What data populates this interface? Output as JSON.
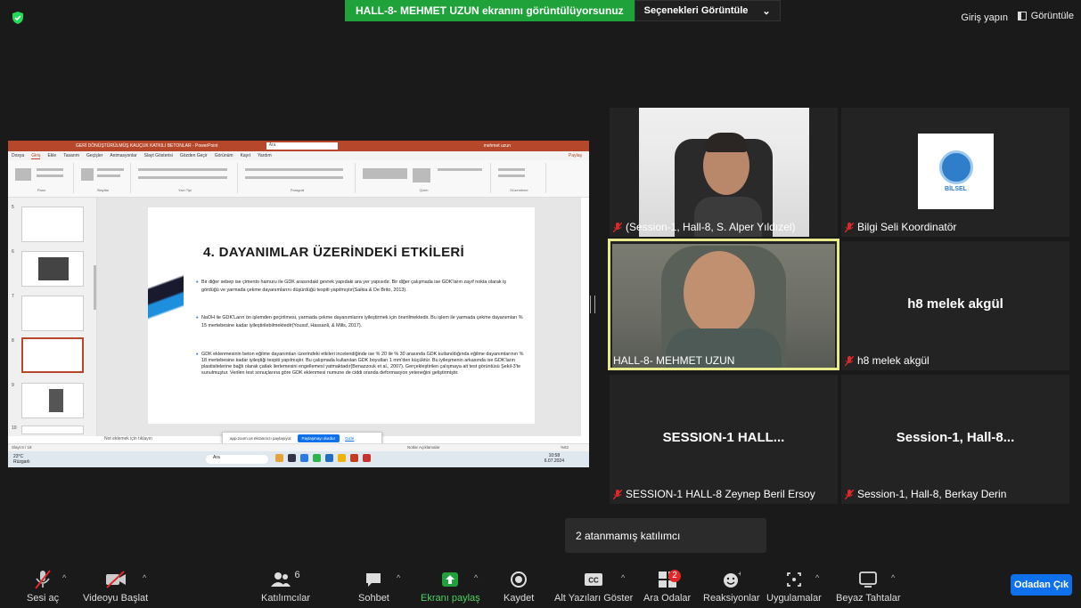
{
  "top": {
    "share_status": "HALL-8- MEHMET UZUN  ekranını görüntülüyorsunuz",
    "view_options": "Seçenekleri Görüntüle",
    "view_options_caret": "⌄",
    "signin": "Giriş yapın",
    "view": "Görüntüle"
  },
  "powerpoint": {
    "title": "GERİ DÖNÜŞTÜRÜLMÜŞ KAUÇUK KATKILI BETONLAR - PowerPoint",
    "search": "Ara",
    "user": "mehmet uzun",
    "menu": [
      "Dosya",
      "Giriş",
      "Ekle",
      "Tasarım",
      "Geçişler",
      "Animasyonlar",
      "Slayt Gösterisi",
      "Gözden Geçir",
      "Görünüm",
      "Kayıt",
      "Yardım"
    ],
    "share": "Paylaş",
    "ribbon_groups": [
      "Pano",
      "Slaytlar",
      "Yazı Tipi",
      "Paragraf",
      "Çizim",
      "Düzenleme"
    ],
    "thumb_numbers": [
      "5",
      "6",
      "7",
      "8",
      "9",
      "10"
    ],
    "notes": "Not eklemek için tıklayın",
    "status": "Slayt 8 / 18",
    "status_right": "Notlar   Açıklamalar",
    "zoom": "%82"
  },
  "slide": {
    "title": "4. DAYANIMLAR ÜZERİNDEKİ ETKİLERİ",
    "bullets": [
      "Bir diğer sebep ise çimento hamuru ile GDK arasındaki gevrek yapıdaki ara yer yapısıdır. Bir diğer çalışmada ise GDK'ların zayıf nokta olarak iş gördüğü ve yarmada çekme dayanımlarını düşürdüğü tespiti yapılmıştır(Saikia & De Brito, 2013).",
      "NaOH ile GDK'Ların ön işlemden geçirilmesi, yarmada çekme dayanımlarını iyileştirmek için önerilmektedir. Bu işlem ile yarmada çekme dayanımları % 15 mertebesine kadar iyileştirilebilmektedir(Youssf, Hassanli, & Mills, 2017).",
      "GDK eklenmesinin beton eğilme dayanımları üzerindeki etkileri incelendiğinde ise % 20 ile % 30 arasında GDK kullanıldığında eğilme dayanımlarının % 18 mertebesine kadar iyileştiği tespiti yapılmıştır. Bu çalışmada kullanılan GDK boyutları 1 mm'den küçüktür. Bu iyileşmenin arkasında ise GDK'ların plastisitelerine bağlı olarak çatlak ilerlemesini engellemesi yatmaktadır(Benazzouk et al., 2007). Gerçekleştirilen çalışmaya ait test görüntüsü Şekil-3'te sunulmuştur. Verilen test sonuçlarına göre GDK eklenmesi numune de ciddi oranda deformasyon yeteneğini geliştirmiştir."
    ]
  },
  "share_popup": {
    "text": "app.zoom.us ekranınızı paylaşıyor.",
    "stop": "Paylaşmayı durdur",
    "hide": "Gizle"
  },
  "taskbar": {
    "temp": "23°C",
    "weather": "Rüzgarlı",
    "search": "Ara",
    "time": "10:58",
    "date": "6.07.2024"
  },
  "participants": [
    {
      "name": "(Session-1, Hall-8, S. Alper Yıldızel)",
      "muted": true,
      "video": true
    },
    {
      "name": "Bilgi Seli Koordinatör",
      "muted": true,
      "logo": "BİLSEL"
    },
    {
      "name": "HALL-8- MEHMET UZUN",
      "muted": false,
      "video": true,
      "active": true
    },
    {
      "name": "h8 melek akgül",
      "muted": true,
      "display": "h8 melek akgül"
    },
    {
      "name": "SESSION-1 HALL-8 Zeynep Beril Ersoy",
      "muted": true,
      "display": "SESSION-1  HALL..."
    },
    {
      "name": "Session-1, Hall-8, Berkay Derin",
      "muted": true,
      "display": "Session-1,  Hall-8..."
    }
  ],
  "tooltip": "2 atanmamış katılımcı",
  "toolbar": {
    "audio": "Sesi aç",
    "video": "Videoyu Başlat",
    "participants": "Katılımcılar",
    "participants_count": "6",
    "chat": "Sohbet",
    "share": "Ekranı paylaş",
    "record": "Kaydet",
    "captions": "Alt Yazıları Göster",
    "breakout": "Ara Odalar",
    "breakout_badge": "2",
    "reactions": "Reaksiyonlar",
    "apps": "Uygulamalar",
    "whiteboard": "Beyaz Tahtalar",
    "leave": "Odadan Çık"
  }
}
